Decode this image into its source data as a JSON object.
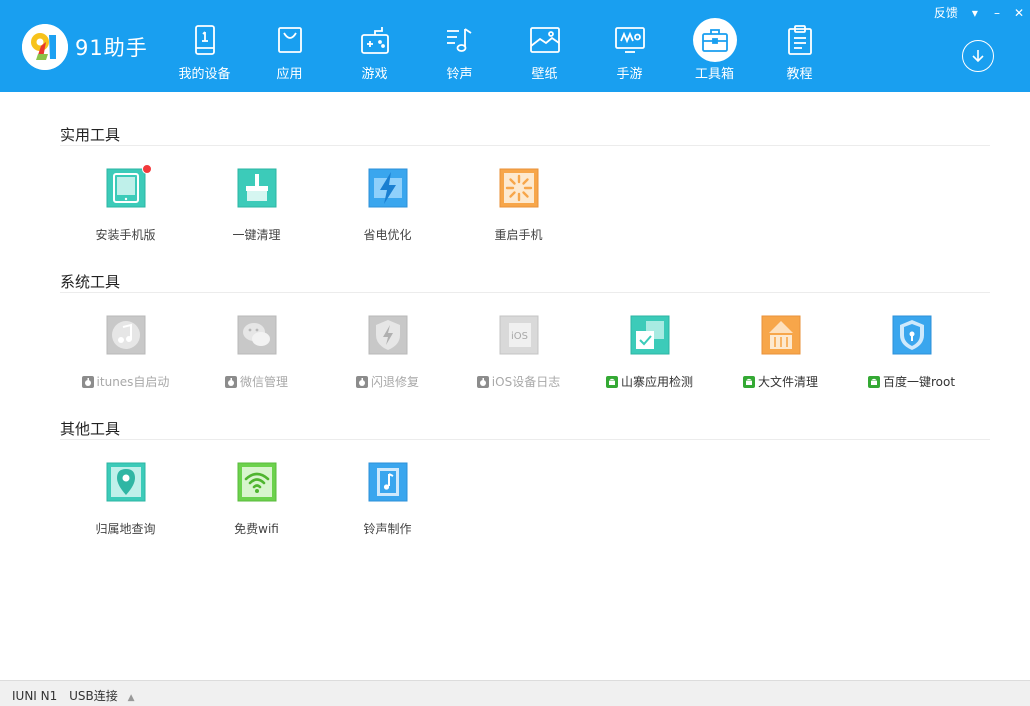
{
  "app": {
    "logo_text": "91助手",
    "accent_color": "#199ff0"
  },
  "nav": [
    {
      "label": "我的设备",
      "icon": "phone-icon"
    },
    {
      "label": "应用",
      "icon": "shopping-bag-icon"
    },
    {
      "label": "游戏",
      "icon": "gamepad-icon"
    },
    {
      "label": "铃声",
      "icon": "music-note-icon"
    },
    {
      "label": "壁纸",
      "icon": "picture-icon"
    },
    {
      "label": "手游",
      "icon": "monitor-game-icon"
    },
    {
      "label": "工具箱",
      "icon": "toolbox-icon",
      "active": true
    },
    {
      "label": "教程",
      "icon": "clipboard-icon"
    }
  ],
  "window": {
    "feedback": "反馈",
    "dropdown_glyph": "▾",
    "minimize_glyph": "–",
    "close_glyph": "✕"
  },
  "sections": [
    {
      "title": "实用工具",
      "tools": [
        {
          "label": "安装手机版",
          "icon": "tablet-icon",
          "badge": true
        },
        {
          "label": "一键清理",
          "icon": "broom-icon"
        },
        {
          "label": "省电优化",
          "icon": "lightning-icon"
        },
        {
          "label": "重启手机",
          "icon": "restart-icon"
        }
      ]
    },
    {
      "title": "系统工具",
      "tools": [
        {
          "label": "itunes自启动",
          "icon": "itunes-icon",
          "platform": "apple",
          "disabled": true
        },
        {
          "label": "微信管理",
          "icon": "wechat-icon",
          "platform": "apple",
          "disabled": true
        },
        {
          "label": "闪退修复",
          "icon": "shield-bolt-icon",
          "platform": "apple",
          "disabled": true
        },
        {
          "label": "iOS设备日志",
          "icon": "ios-log-icon",
          "platform": "apple",
          "disabled": true
        },
        {
          "label": "山寨应用检测",
          "icon": "app-check-icon",
          "platform": "android"
        },
        {
          "label": "大文件清理",
          "icon": "big-file-icon",
          "platform": "android"
        },
        {
          "label": "百度一键root",
          "icon": "shield-lock-icon",
          "platform": "android"
        }
      ]
    },
    {
      "title": "其他工具",
      "tools": [
        {
          "label": "归属地查询",
          "icon": "location-pin-icon"
        },
        {
          "label": "免费wifi",
          "icon": "wifi-icon"
        },
        {
          "label": "铃声制作",
          "icon": "ringtone-maker-icon"
        }
      ]
    }
  ],
  "status": {
    "device": "IUNI N1",
    "connection": "USB连接"
  }
}
